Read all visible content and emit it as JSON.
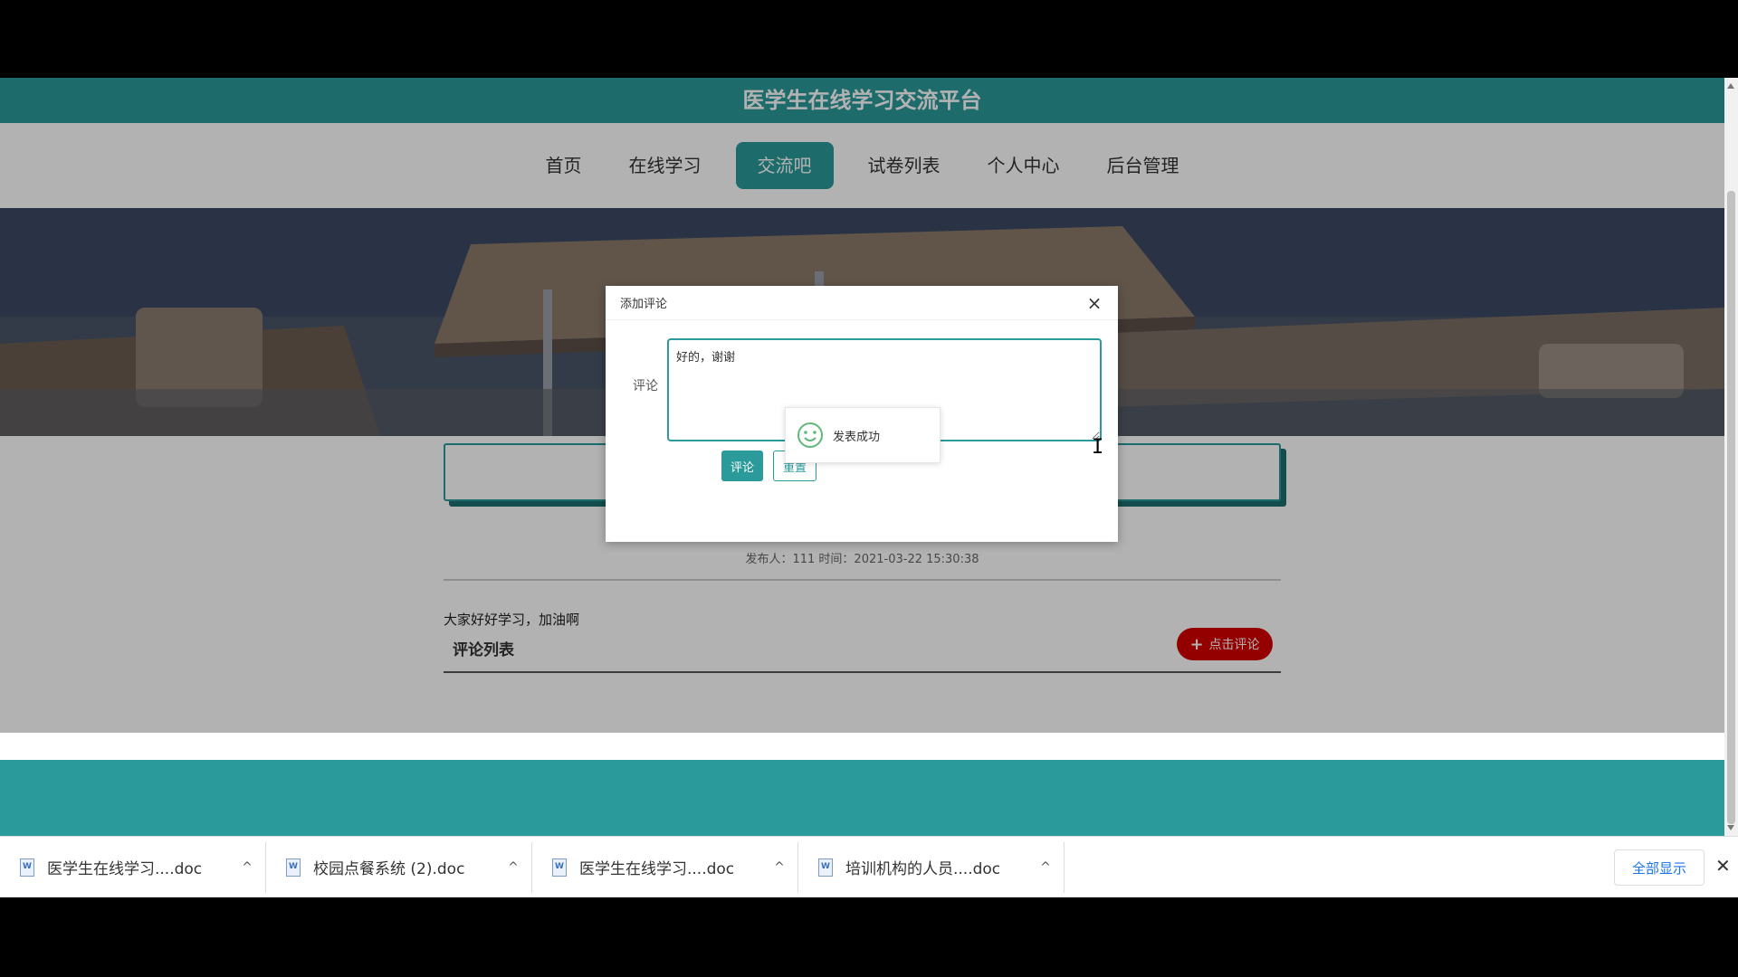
{
  "site": {
    "title": "医学生在线学习交流平台",
    "nav": [
      {
        "label": "首页",
        "active": false
      },
      {
        "label": "在线学习",
        "active": false
      },
      {
        "label": "交流吧",
        "active": true
      },
      {
        "label": "试卷列表",
        "active": false
      },
      {
        "label": "个人中心",
        "active": false
      },
      {
        "label": "后台管理",
        "active": false
      }
    ],
    "accent_color": "#2a9a9a"
  },
  "post": {
    "meta": "发布人：111 时间：2021-03-22 15:30:38",
    "body": "大家好好学习，加油啊",
    "comments_title": "评论列表",
    "add_comment_label": "点击评论"
  },
  "modal": {
    "title": "添加评论",
    "field_label": "评论",
    "comment_value": "好的，谢谢",
    "submit_label": "评论",
    "reset_label": "重置"
  },
  "toast": {
    "message": "发表成功"
  },
  "downloads": {
    "items": [
      {
        "name": "医学生在线学习....doc"
      },
      {
        "name": "校园点餐系统 (2).doc"
      },
      {
        "name": "医学生在线学习....doc"
      },
      {
        "name": "培训机构的人员....doc"
      }
    ],
    "show_all_label": "全部显示"
  }
}
